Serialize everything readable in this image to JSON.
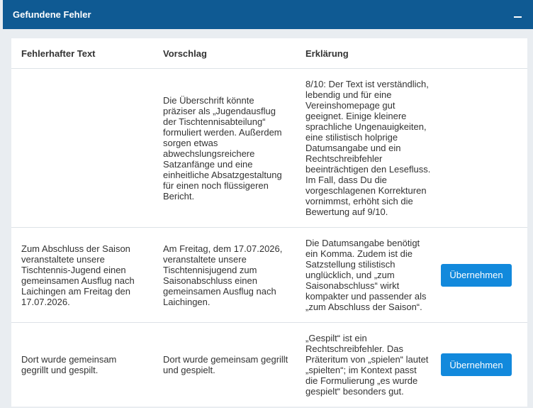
{
  "panel": {
    "title": "Gefundene Fehler",
    "collapse_icon": "minus-icon"
  },
  "table": {
    "headers": [
      "Fehlerhafter Text",
      "Vorschlag",
      "Erklärung",
      ""
    ],
    "rows": [
      {
        "original": "",
        "suggestion": "Die Überschrift könnte präziser als „Jugendausflug der Tischtennisabteilung“ formuliert werden. Außerdem sorgen etwas abwechslungsreichere Satzanfänge und eine einheitliche Absatzgestaltung für einen noch flüssigeren Bericht.",
        "explanation": "8/10: Der Text ist verständlich, lebendig und für eine Vereinshomepage gut geeignet. Einige kleinere sprachliche Ungenauigkeiten, eine stilistisch holprige Datumsangabe und ein Rechtschreibfehler beeinträchtigen den Lesefluss. Im Fall, dass Du die vorgeschlagenen Korrekturen vornimmst, erhöht sich die Bewertung auf 9/10.",
        "button": ""
      },
      {
        "original": "Zum Abschluss der Saison veranstaltete unsere Tischtennis-Jugend einen gemeinsamen Ausflug nach Laichingen am Freitag den 17.07.2026.",
        "suggestion": "Am Freitag, dem 17.07.2026, veranstaltete unsere Tischtennisjugend zum Saisonabschluss einen gemeinsamen Ausflug nach Laichingen.",
        "explanation": "Die Datumsangabe benötigt ein Komma. Zudem ist die Satzstellung stilistisch unglücklich, und „zum Saisonabschluss“ wirkt kompakter und passender als „zum Abschluss der Saison“.",
        "button": "Übernehmen"
      },
      {
        "original": "Dort wurde gemeinsam gegrillt und gespilt.",
        "suggestion": "Dort wurde gemeinsam gegrillt und gespielt.",
        "explanation": "„Gespilt“ ist ein Rechtschreibfehler. Das Präteritum von „spielen“ lautet „spielten“; im Kontext passt die Formulierung „es wurde gespielt“ besonders gut.",
        "button": "Übernehmen"
      }
    ]
  },
  "colors": {
    "header_bg": "#0f5a93",
    "button_bg": "#1289dc",
    "page_bg": "#e9edf1"
  }
}
